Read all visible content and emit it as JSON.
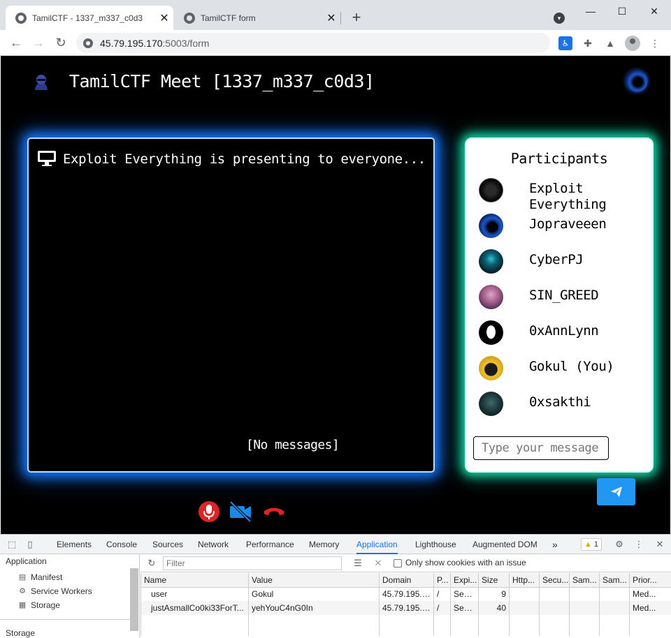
{
  "browser": {
    "tabs": [
      {
        "title": "TamilCTF - 1337_m337_c0d3",
        "close": "✕"
      },
      {
        "title": "TamilCTF form",
        "close": "✕"
      }
    ],
    "new_tab": "+",
    "address": {
      "host": "45.79.195.170",
      "path": ":5003/form"
    }
  },
  "page": {
    "title": "TamilCTF Meet [1337_m337_c0d3]",
    "presenting_text": "Exploit Everything is presenting to everyone...",
    "no_messages": "[No messages]",
    "participants_title": "Participants",
    "participants": [
      {
        "name": "Exploit Everything"
      },
      {
        "name": "Jopraveeen"
      },
      {
        "name": "CyberPJ"
      },
      {
        "name": "SIN_GREED"
      },
      {
        "name": "0xAnnLynn"
      },
      {
        "name": "Gokul (You)"
      },
      {
        "name": "0xsakthi"
      }
    ],
    "message_placeholder": "Type your message",
    "colors": {
      "video_glow": "#1677ff",
      "participants_glow": "#14d6a8",
      "send_button": "#2196f3",
      "control_red": "#e02424",
      "control_blue": "#1e88e5"
    }
  },
  "devtools": {
    "tabs": [
      "Elements",
      "Console",
      "Sources",
      "Network",
      "Performance",
      "Memory",
      "Application",
      "Lighthouse",
      "Augmented DOM"
    ],
    "more": "»",
    "warnings": "1",
    "sidebar": {
      "section": "Application",
      "items": [
        "Manifest",
        "Service Workers",
        "Storage"
      ],
      "section2": "Storage"
    },
    "filter_placeholder": "Filter",
    "only_issue_label": "Only show cookies with an issue",
    "columns": [
      "Name",
      "Value",
      "Domain",
      "P...",
      "Expi...",
      "Size",
      "Http...",
      "Secu...",
      "Sam...",
      "Sam...",
      "Prior..."
    ],
    "cookies": [
      {
        "name": "user",
        "value": "Gokul",
        "domain": "45.79.195.1...",
        "path": "/",
        "expires": "Sess...",
        "size": "9",
        "priority": "Med..."
      },
      {
        "name": "justAsmallCo0ki33ForT...",
        "value": "yehYouC4nG0In",
        "domain": "45.79.195.1...",
        "path": "/",
        "expires": "Sess...",
        "size": "40",
        "priority": "Med..."
      }
    ]
  }
}
